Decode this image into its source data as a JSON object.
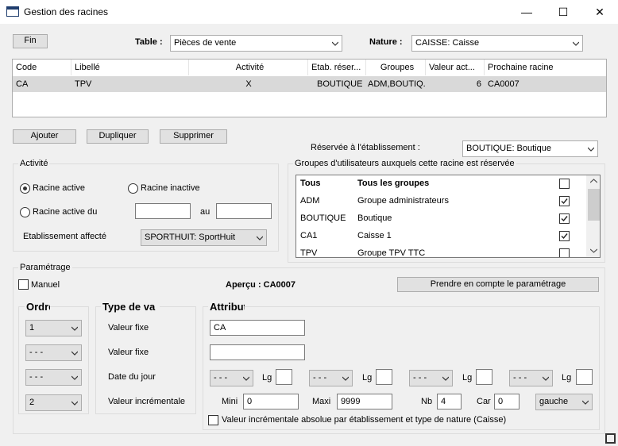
{
  "window": {
    "title": "Gestion des racines",
    "min": "—",
    "max": "☐",
    "close": "✕"
  },
  "toolbar": {
    "fin": "Fin",
    "table_label": "Table :",
    "table_value": "Pièces de vente",
    "nature_label": "Nature :",
    "nature_value": "CAISSE: Caisse"
  },
  "grid": {
    "headers": [
      "Code",
      "Libellé",
      "Activité",
      "Etab. réser...",
      "Groupes",
      "Valeur act...",
      "Prochaine racine"
    ],
    "rows": [
      [
        "CA",
        "TPV",
        "X",
        "BOUTIQUE",
        "ADM,BOUTIQ...",
        "6",
        "CA0007"
      ]
    ]
  },
  "actions": {
    "add": "Ajouter",
    "duplicate": "Dupliquer",
    "delete": "Supprimer"
  },
  "reserved": {
    "label": "Réservée à l'établissement :",
    "value": "BOUTIQUE: Boutique"
  },
  "activity": {
    "title": "Activité",
    "active": "Racine active",
    "inactive": "Racine inactive",
    "active_from": "Racine active du",
    "to": "au",
    "from_value": "",
    "to_value": "",
    "etab_label": "Etablissement affecté",
    "etab_value": "SPORTHUIT: SportHuit"
  },
  "groups": {
    "title": "Groupes d'utilisateurs auxquels cette racine est réservée",
    "items": [
      {
        "code": "Tous",
        "name": "Tous les groupes",
        "checked": false,
        "bold": true
      },
      {
        "code": "ADM",
        "name": "Groupe administrateurs",
        "checked": true
      },
      {
        "code": "BOUTIQUE",
        "name": "Boutique",
        "checked": true
      },
      {
        "code": "CA1",
        "name": "Caisse 1",
        "checked": true
      },
      {
        "code": "TPV",
        "name": "Groupe TPV TTC",
        "checked": false
      }
    ]
  },
  "param": {
    "title": "Paramétrage",
    "manual": "Manuel",
    "preview": "Aperçu : CA0007",
    "apply": "Prendre en compte le paramétrage",
    "order_title": "Ordre",
    "type_title": "Type de va",
    "attr_title": "Attribut",
    "orders": [
      "1",
      "- - -",
      "- - -",
      "2"
    ],
    "types": [
      "Valeur fixe",
      "Valeur fixe",
      "Date du jour",
      "Valeur incrémentale"
    ],
    "attr_fixed1": "CA",
    "attr_fixed2": "",
    "date_combos": [
      "- - -",
      "- - -",
      "- - -",
      "- - -"
    ],
    "lg_label": "Lg",
    "mini_label": "Mini",
    "mini_value": "0",
    "maxi_label": "Maxi",
    "maxi_value": "9999",
    "nb_label": "Nb",
    "nb_value": "4",
    "car_label": "Car",
    "car_value": "0",
    "align_value": "gauche",
    "absolute_label": "Valeur incrémentale absolue par établissement et type de nature (Caisse)"
  }
}
